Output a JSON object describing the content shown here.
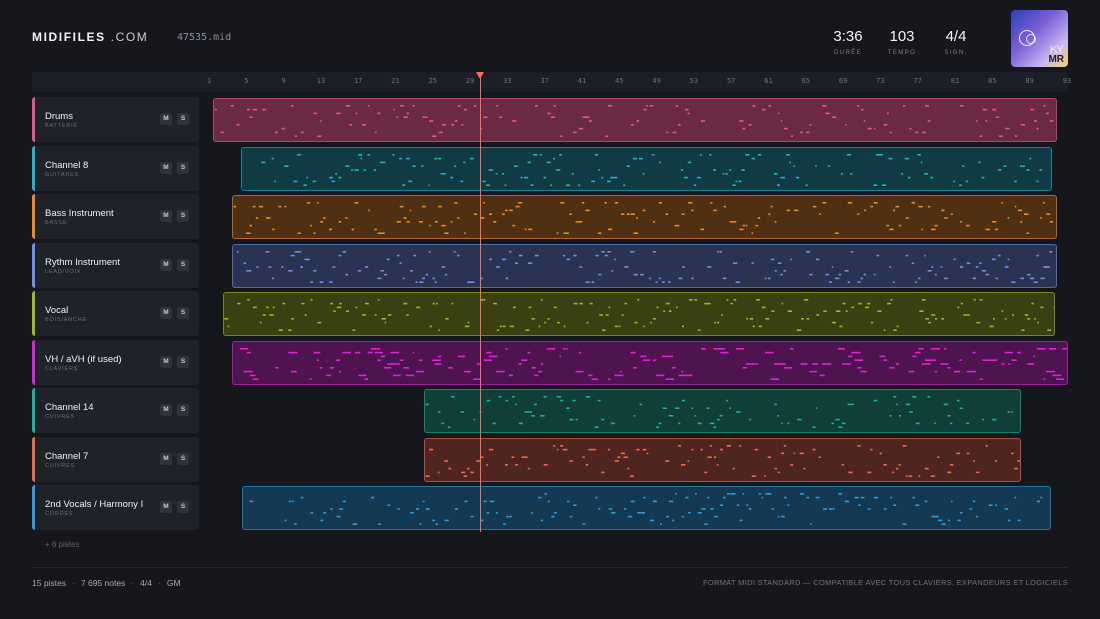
{
  "header": {
    "brand_bold": "MIDIFILES",
    "brand_domain": " .COM",
    "filename": "47535.mid",
    "stats": [
      {
        "value": "3:36",
        "label": "DURÉE"
      },
      {
        "value": "103",
        "label": "TEMPO"
      },
      {
        "value": "4/4",
        "label": "SIGN."
      }
    ],
    "cover": {
      "ky": "KY",
      "mr": "MR"
    }
  },
  "ruler": {
    "ticks": [
      "1",
      "5",
      "9",
      "13",
      "17",
      "21",
      "25",
      "29",
      "33",
      "37",
      "41",
      "45",
      "49",
      "53",
      "57",
      "61",
      "65",
      "69",
      "73",
      "77",
      "81",
      "85",
      "89",
      "93"
    ]
  },
  "tracks": [
    {
      "name": "Drums",
      "sub": "BATTERIE",
      "color": "#e8558a",
      "mute": "M",
      "solo": "S",
      "notes_bg": "#6a2a43"
    },
    {
      "name": "Channel 8",
      "sub": "GUITARES",
      "color": "#1fb5c9",
      "mute": "M",
      "solo": "S",
      "notes_bg": "#103b45"
    },
    {
      "name": "Bass Instrument",
      "sub": "BASSE",
      "color": "#f08a1e",
      "mute": "M",
      "solo": "S",
      "notes_bg": "#4f3013"
    },
    {
      "name": "Rythm Instrument",
      "sub": "LEAD/VOIX",
      "color": "#6f8ff0",
      "mute": "M",
      "solo": "S",
      "notes_bg": "#2a3352"
    },
    {
      "name": "Vocal",
      "sub": "BOIS/ANCHE",
      "color": "#9cbb16",
      "mute": "M",
      "solo": "S",
      "notes_bg": "#3a4012"
    },
    {
      "name": "VH / aVH (if used)",
      "sub": "CLAVIERS",
      "color": "#de22d8",
      "mute": "M",
      "solo": "S",
      "notes_bg": "#4d1450"
    },
    {
      "name": "Channel 14",
      "sub": "CUIVRES",
      "color": "#17b39a",
      "mute": "M",
      "solo": "S",
      "notes_bg": "#103e39"
    },
    {
      "name": "Channel 7",
      "sub": "CUIVRES",
      "color": "#f06a4e",
      "mute": "M",
      "solo": "S",
      "notes_bg": "#4e261f"
    },
    {
      "name": "2nd Vocals / Harmony I",
      "sub": "CORDES",
      "color": "#2c9be0",
      "mute": "M",
      "solo": "S",
      "notes_bg": "#133a52"
    }
  ],
  "more_tracks": "+ 6 pistes",
  "footer": {
    "tracks": "15 pistes",
    "notes": "7 695 notes",
    "signature": "4/4",
    "standard": "GM",
    "right": "FORMAT MIDI STANDARD — COMPATIBLE AVEC TOUS CLAVIERS, EXPANDEURS ET LOGICIELS"
  },
  "playhead_bar": 29
}
